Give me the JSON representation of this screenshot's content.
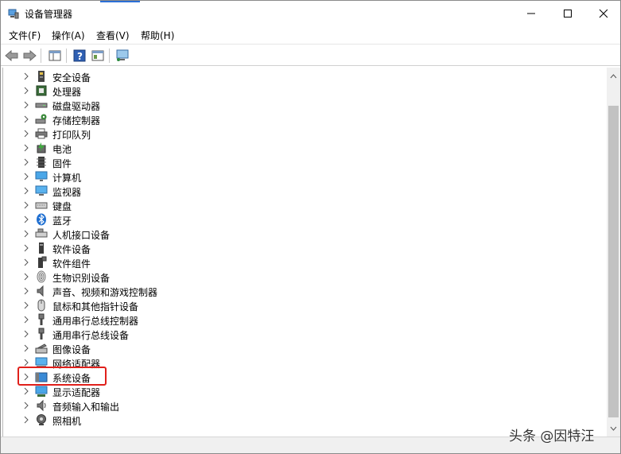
{
  "window": {
    "title": "设备管理器"
  },
  "menu": [
    {
      "label": "文件(F)"
    },
    {
      "label": "操作(A)"
    },
    {
      "label": "查看(V)"
    },
    {
      "label": "帮助(H)"
    }
  ],
  "tree": {
    "items": [
      {
        "label": "安全设备",
        "icon": "security-chip-icon"
      },
      {
        "label": "处理器",
        "icon": "processor-icon"
      },
      {
        "label": "磁盘驱动器",
        "icon": "disk-drive-icon"
      },
      {
        "label": "存储控制器",
        "icon": "storage-controller-icon"
      },
      {
        "label": "打印队列",
        "icon": "printer-icon"
      },
      {
        "label": "电池",
        "icon": "battery-icon"
      },
      {
        "label": "固件",
        "icon": "firmware-icon"
      },
      {
        "label": "计算机",
        "icon": "computer-icon"
      },
      {
        "label": "监视器",
        "icon": "monitor-icon"
      },
      {
        "label": "键盘",
        "icon": "keyboard-icon"
      },
      {
        "label": "蓝牙",
        "icon": "bluetooth-icon"
      },
      {
        "label": "人机接口设备",
        "icon": "hid-icon"
      },
      {
        "label": "软件设备",
        "icon": "software-device-icon"
      },
      {
        "label": "软件组件",
        "icon": "software-component-icon"
      },
      {
        "label": "生物识别设备",
        "icon": "fingerprint-icon"
      },
      {
        "label": "声音、视频和游戏控制器",
        "icon": "speaker-icon"
      },
      {
        "label": "鼠标和其他指针设备",
        "icon": "mouse-icon"
      },
      {
        "label": "通用串行总线控制器",
        "icon": "usb-icon"
      },
      {
        "label": "通用串行总线设备",
        "icon": "usb-icon"
      },
      {
        "label": "图像设备",
        "icon": "camera-icon"
      },
      {
        "label": "网络适配器",
        "icon": "network-icon"
      },
      {
        "label": "系统设备",
        "icon": "system-device-icon"
      },
      {
        "label": "显示适配器",
        "icon": "display-adapter-icon"
      },
      {
        "label": "音频输入和输出",
        "icon": "audio-io-icon"
      },
      {
        "label": "照相机",
        "icon": "webcam-icon"
      }
    ]
  },
  "highlight_color": "#e0201b",
  "watermark": "头条 @因特汪"
}
